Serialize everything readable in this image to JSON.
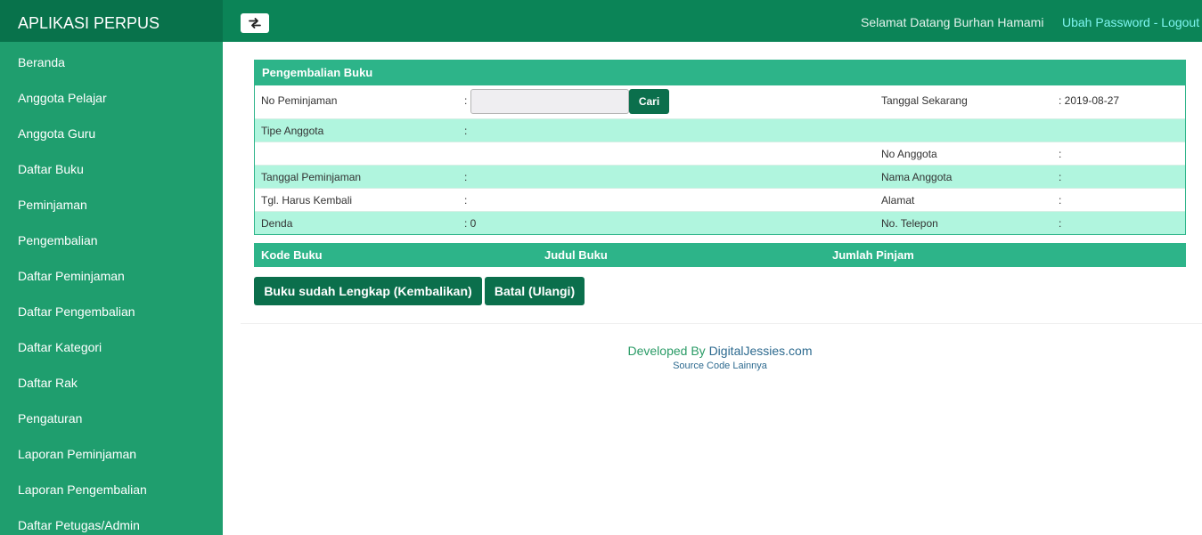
{
  "app": {
    "title": "APLIKASI PERPUS"
  },
  "header": {
    "welcome": "Selamat Datang Burhan Hamami",
    "change_password": "Ubah Password",
    "separator": " - ",
    "logout": "Logout"
  },
  "sidebar": {
    "items": [
      {
        "label": "Beranda"
      },
      {
        "label": "Anggota Pelajar"
      },
      {
        "label": "Anggota Guru"
      },
      {
        "label": "Daftar Buku"
      },
      {
        "label": "Peminjaman"
      },
      {
        "label": "Pengembalian"
      },
      {
        "label": "Daftar Peminjaman"
      },
      {
        "label": "Daftar Pengembalian"
      },
      {
        "label": "Daftar Kategori"
      },
      {
        "label": "Daftar Rak"
      },
      {
        "label": "Pengaturan"
      },
      {
        "label": "Laporan Peminjaman"
      },
      {
        "label": "Laporan Pengembalian"
      },
      {
        "label": "Daftar Petugas/Admin"
      }
    ]
  },
  "form": {
    "title": "Pengembalian Buku",
    "loan_number_label": "No Peminjaman",
    "loan_number_value": "",
    "loan_number_placeholder": "",
    "search_button": "Cari",
    "current_date_label": "Tanggal Sekarang",
    "current_date_value": ": 2019-08-27",
    "member_type_label": "Tipe Anggota",
    "member_no_label": "No Anggota",
    "loan_date_label": "Tanggal Peminjaman",
    "member_name_label": "Nama Anggota",
    "due_date_label": "Tgl. Harus Kembali",
    "address_label": "Alamat",
    "fine_label": "Denda",
    "fine_value": ": 0",
    "phone_label": "No. Telepon",
    "colon": ":"
  },
  "books_table": {
    "columns": [
      "Kode Buku",
      "Judul Buku",
      "Jumlah Pinjam"
    ]
  },
  "actions": {
    "return_button": "Buku sudah Lengkap (Kembalikan)",
    "cancel_button": "Batal (Ulangi)"
  },
  "footer": {
    "developed_by": "Developed By ",
    "developer": "DigitalJessies.com",
    "source_code": "Source Code Lainnya"
  },
  "colors": {
    "topbar": "#0b8457",
    "brand": "#08724b",
    "sidebar": "#1f9e6e",
    "panel_header": "#2db489",
    "row_alt": "#b0f5de",
    "button": "#0b6f4c",
    "header_link": "#7ff5f0"
  },
  "icons": {
    "toggle": "swap-arrows-icon"
  }
}
